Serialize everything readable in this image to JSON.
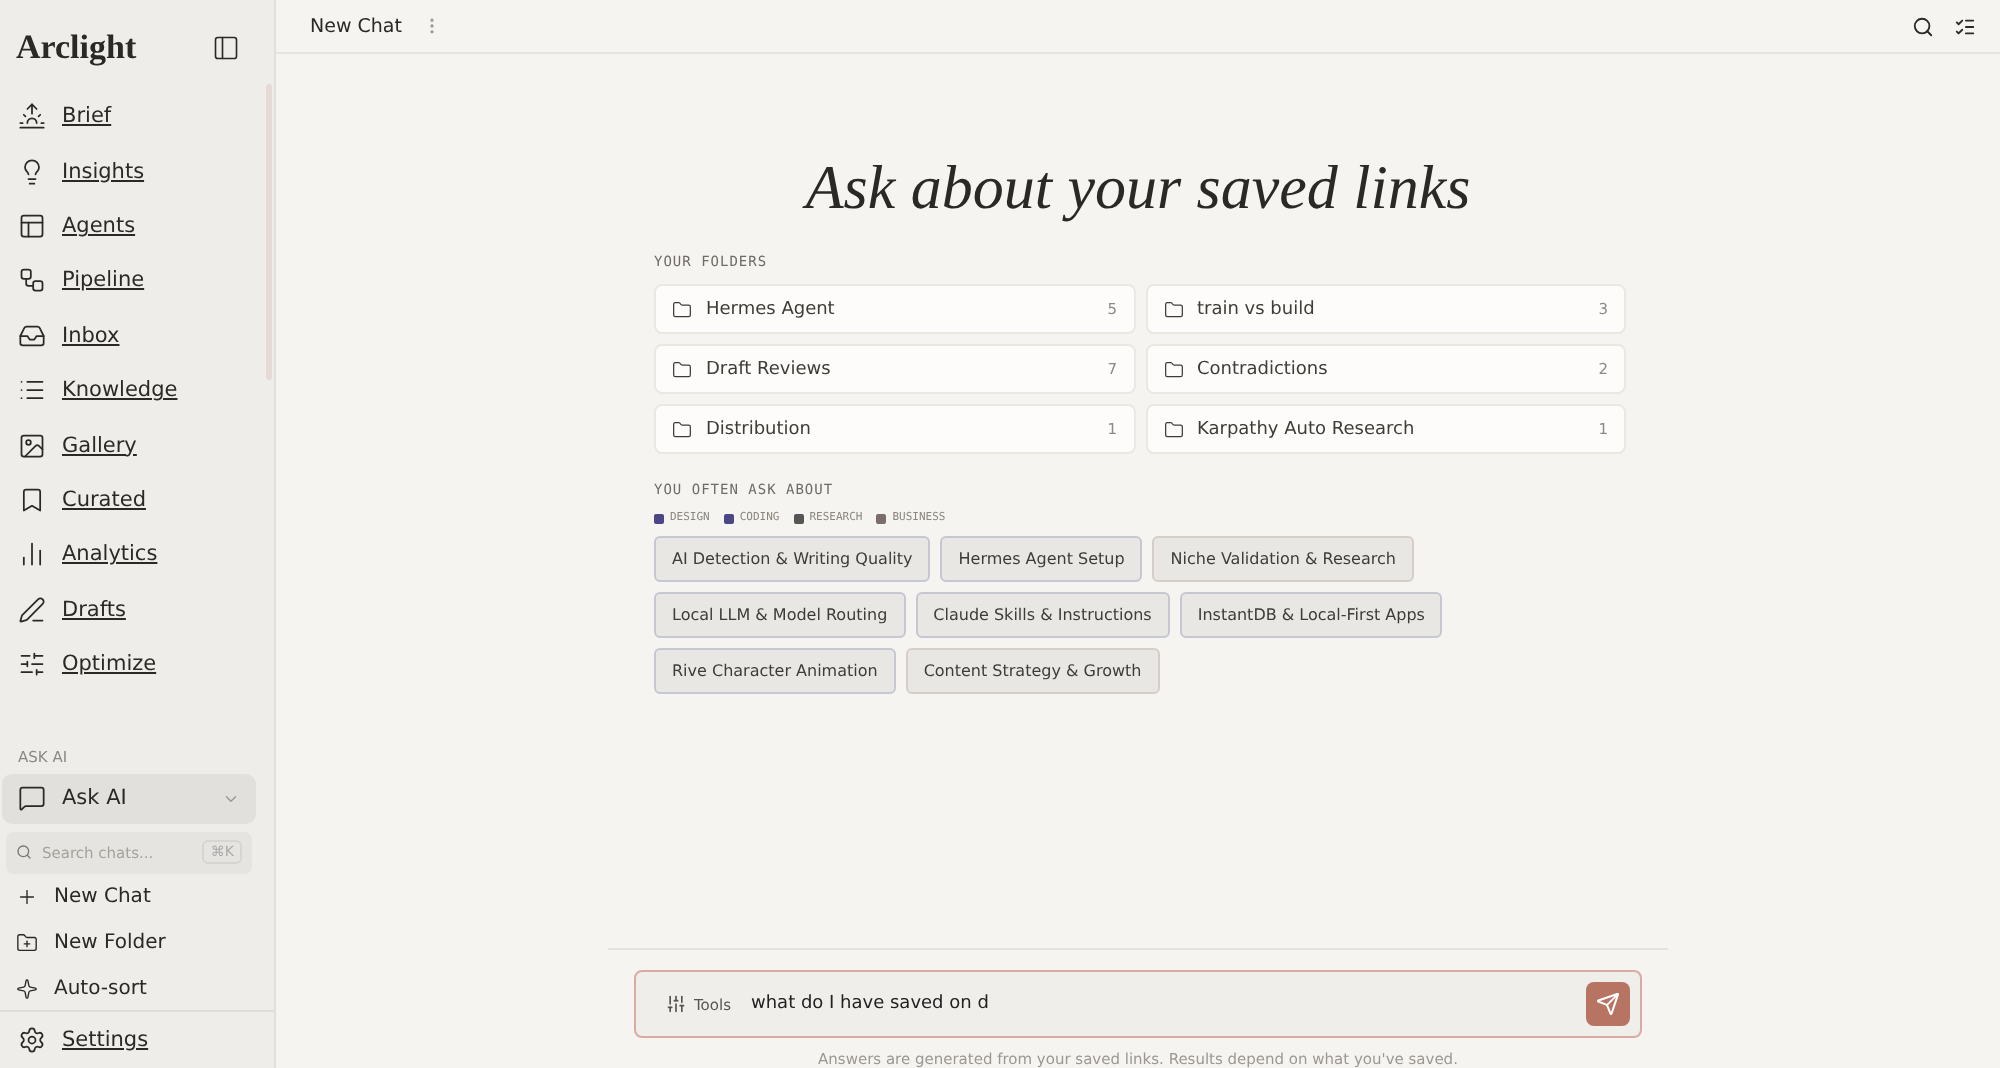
{
  "sidebar": {
    "brand": "Arclight",
    "nav": [
      {
        "label": "Brief"
      },
      {
        "label": "Insights"
      },
      {
        "label": "Agents"
      },
      {
        "label": "Pipeline"
      },
      {
        "label": "Inbox"
      },
      {
        "label": "Knowledge"
      },
      {
        "label": "Gallery"
      },
      {
        "label": "Curated"
      },
      {
        "label": "Analytics"
      },
      {
        "label": "Drafts"
      },
      {
        "label": "Optimize"
      }
    ],
    "section_label": "ASK AI",
    "ask_ai": {
      "label": "Ask AI",
      "expanded": true
    },
    "search": {
      "placeholder": "Search chats...",
      "shortcut": "⌘K"
    },
    "actions": [
      {
        "label": "New Chat"
      },
      {
        "label": "New Folder"
      },
      {
        "label": "Auto-sort"
      }
    ],
    "settings": "Settings"
  },
  "header": {
    "title": "New Chat"
  },
  "hero": "Ask about your saved links",
  "folders": {
    "label": "YOUR FOLDERS",
    "items": [
      {
        "name": "Hermes Agent",
        "count": "5"
      },
      {
        "name": "train vs build",
        "count": "3"
      },
      {
        "name": "Draft Reviews",
        "count": "7"
      },
      {
        "name": "Contradictions",
        "count": "2"
      },
      {
        "name": "Distribution",
        "count": "1"
      },
      {
        "name": "Karpathy Auto Research",
        "count": "1"
      }
    ]
  },
  "topics": {
    "label": "YOU OFTEN ASK ABOUT",
    "legend": [
      {
        "label": "DESIGN",
        "color": "#4b4786"
      },
      {
        "label": "CODING",
        "color": "#4b4786"
      },
      {
        "label": "RESEARCH",
        "color": "#555555"
      },
      {
        "label": "BUSINESS",
        "color": "#7b6e6a"
      }
    ],
    "chips": [
      {
        "label": "AI Detection & Writing Quality",
        "color": "#c6c7d3"
      },
      {
        "label": "Hermes Agent Setup",
        "color": "#c6c7d3"
      },
      {
        "label": "Niche Validation & Research",
        "color": "#d6cec6"
      },
      {
        "label": "Local LLM & Model Routing",
        "color": "#c6c7d3"
      },
      {
        "label": "Claude Skills & Instructions",
        "color": "#c6c7d3"
      },
      {
        "label": "InstantDB & Local-First Apps",
        "color": "#c6c7d3"
      },
      {
        "label": "Rive Character Animation",
        "color": "#c6c7d3"
      },
      {
        "label": "Content Strategy & Growth",
        "color": "#d6cec6"
      }
    ]
  },
  "composer": {
    "tools": "Tools",
    "value": "what do I have saved on d"
  },
  "footnote": "Answers are generated from your saved links. Results depend on what you've saved."
}
